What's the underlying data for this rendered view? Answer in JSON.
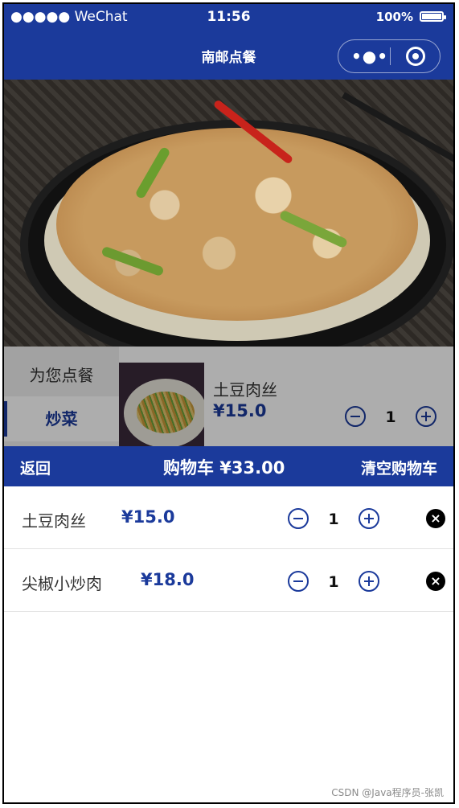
{
  "status_bar": {
    "carrier": "●●●●● WeChat",
    "time": "11:56",
    "battery": "100%",
    "battery_level": 1.0
  },
  "navbar": {
    "title": "南邮点餐",
    "more_icon": "more-dots-icon",
    "close_icon": "target-icon"
  },
  "banner": {
    "image": "dish-photo"
  },
  "menu": {
    "categories": [
      {
        "label": "为您点餐"
      },
      {
        "label": "炒菜"
      }
    ],
    "dish": {
      "name": "土豆肉丝",
      "price": "¥15.0",
      "quantity": "1"
    }
  },
  "cart_bar": {
    "back_label": "返回",
    "total_label": "购物车 ¥33.00",
    "clear_label": "清空购物车"
  },
  "cart_items": [
    {
      "name": "土豆肉丝",
      "price": "¥15.0",
      "quantity": "1"
    },
    {
      "name": "尖椒小炒肉",
      "price": "¥18.0",
      "quantity": "1"
    }
  ],
  "colors": {
    "primary": "#1b3a9b",
    "background": "#ffffff",
    "separator": "#e2e2e2"
  },
  "watermark": "CSDN @Java程序员-张凯"
}
